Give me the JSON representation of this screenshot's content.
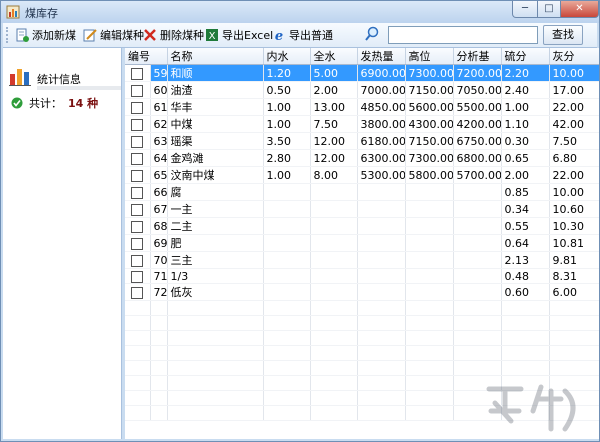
{
  "window": {
    "title": "煤库存",
    "min_label": "─",
    "max_label": "□",
    "close_label": "✕"
  },
  "toolbar": {
    "add": "添加新煤",
    "edit": "编辑煤种",
    "delete": "删除煤种",
    "export_excel": "导出Excel",
    "export_plain": "导出普通",
    "search_placeholder": "",
    "search_button": "查找"
  },
  "sidebar": {
    "title": "统计信息",
    "count_label": "共计：",
    "count_value": "14 种"
  },
  "table": {
    "columns": [
      "编号",
      "名称",
      "内水",
      "全水",
      "发热量",
      "高位",
      "分析基",
      "硫分",
      "灰分"
    ],
    "rows": [
      [
        "59",
        "和顺",
        "1.20",
        "5.00",
        "6900.00",
        "7300.00",
        "7200.00",
        "2.20",
        "10.00"
      ],
      [
        "60",
        "油渣",
        "0.50",
        "2.00",
        "7000.00",
        "7150.00",
        "7050.00",
        "2.40",
        "17.00"
      ],
      [
        "61",
        "华丰",
        "1.00",
        "13.00",
        "4850.00",
        "5600.00",
        "5500.00",
        "1.00",
        "22.00"
      ],
      [
        "62",
        "中煤",
        "1.00",
        "7.50",
        "3800.00",
        "4300.00",
        "4200.00",
        "1.10",
        "42.00"
      ],
      [
        "63",
        "瑶渠",
        "3.50",
        "12.00",
        "6180.00",
        "7150.00",
        "6750.00",
        "0.30",
        "7.50"
      ],
      [
        "64",
        "金鸡滩",
        "2.80",
        "12.00",
        "6300.00",
        "7300.00",
        "6800.00",
        "0.65",
        "6.80"
      ],
      [
        "65",
        "汶南中煤",
        "1.00",
        "8.00",
        "5300.00",
        "5800.00",
        "5700.00",
        "2.00",
        "22.00"
      ],
      [
        "66",
        "腐",
        "",
        "",
        "",
        "",
        "",
        "0.85",
        "10.00"
      ],
      [
        "67",
        "一主",
        "",
        "",
        "",
        "",
        "",
        "0.34",
        "10.60"
      ],
      [
        "68",
        "二主",
        "",
        "",
        "",
        "",
        "",
        "0.55",
        "10.30"
      ],
      [
        "69",
        "肥",
        "",
        "",
        "",
        "",
        "",
        "0.64",
        "10.81"
      ],
      [
        "70",
        "三主",
        "",
        "",
        "",
        "",
        "",
        "2.13",
        "9.81"
      ],
      [
        "71",
        "1/3",
        "",
        "",
        "",
        "",
        "",
        "0.48",
        "8.31"
      ],
      [
        "72",
        "低灰",
        "",
        "",
        "",
        "",
        "",
        "0.60",
        "6.00"
      ]
    ],
    "selected_row": 0
  },
  "colors": {
    "selection": "#3399ff",
    "count_value": "#7a1010"
  }
}
